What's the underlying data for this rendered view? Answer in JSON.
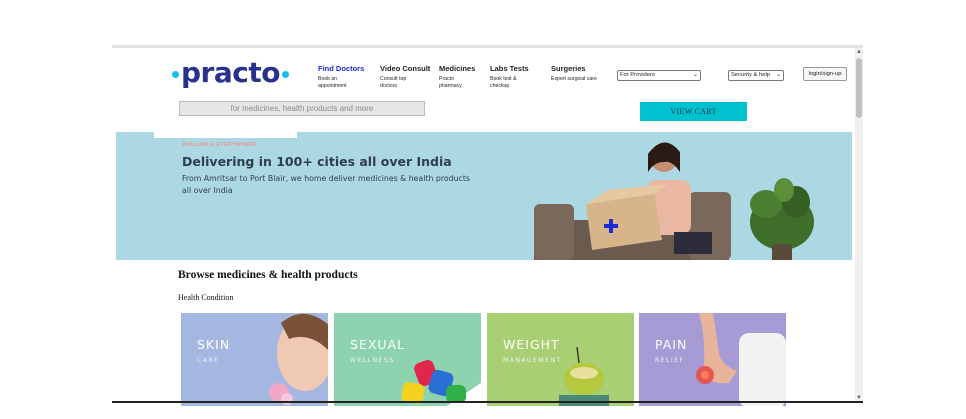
{
  "brand": {
    "name": "practo"
  },
  "nav": [
    {
      "title": "Find Doctors",
      "sub": "Book an appointment",
      "active": true
    },
    {
      "title": "Video Consult",
      "sub": "Consult top doctors",
      "active": false
    },
    {
      "title": "Medicines",
      "sub": "Practo pharmacy",
      "active": false
    },
    {
      "title": "Labs Tests",
      "sub": "Book test & checkup",
      "active": false
    },
    {
      "title": "Surgeries",
      "sub": "Expert surgical care",
      "active": false
    }
  ],
  "providers_select": {
    "value": "For Providers"
  },
  "security_select": {
    "value": "Security & help"
  },
  "login": {
    "label": "login/sign-up"
  },
  "search": {
    "placeholder": "for medicines, health products and more"
  },
  "cart": {
    "label": "VIEW CART"
  },
  "banner": {
    "tag": "AVAILABLE EVERYWHERE",
    "title": "Delivering in 100+ cities all over India",
    "subtitle": "From Amritsar to Port Blair, we home deliver medicines & health products all over India"
  },
  "browse": {
    "title": "Browse medicines & health products",
    "subtitle": "Health Condition"
  },
  "categories": [
    {
      "title": "SKIN",
      "sub": "CARE",
      "color": "#a4b7e0"
    },
    {
      "title": "SEXUAL",
      "sub": "WELLNESS",
      "color": "#8dd3b0"
    },
    {
      "title": "WEIGHT",
      "sub": "MANAGEMENT",
      "color": "#a8cf74"
    },
    {
      "title": "PAIN",
      "sub": "RELIEF",
      "color": "#a79bd6"
    }
  ],
  "colors": {
    "accent": "#14bef0",
    "brand_dark": "#28328c",
    "cart": "#00c2cf",
    "banner_bg": "#acd8e3",
    "nav_active": "#1e2ad6"
  }
}
